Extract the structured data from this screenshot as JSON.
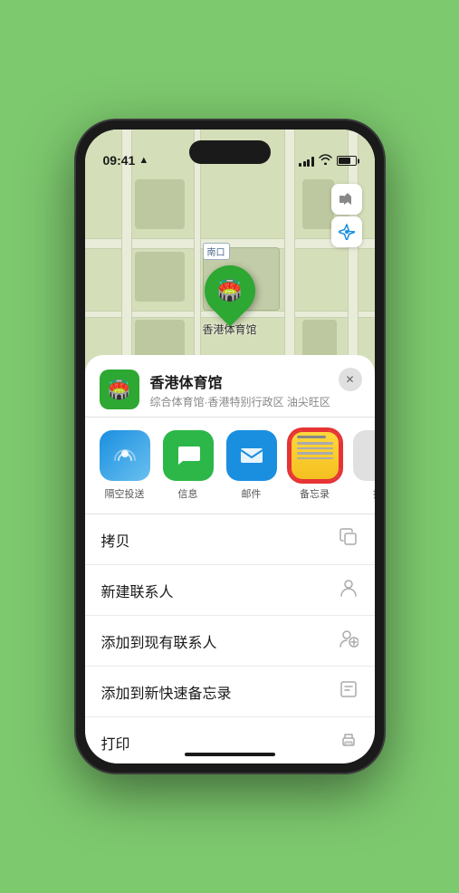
{
  "status_bar": {
    "time": "09:41",
    "location_arrow": "▶"
  },
  "map": {
    "label": "南口",
    "pin_label": "香港体育馆",
    "map_icon": "🗺️",
    "location_icon": "◎"
  },
  "venue": {
    "name": "香港体育馆",
    "subtitle": "综合体育馆·香港特别行政区 油尖旺区",
    "icon": "🏟️"
  },
  "share_items": [
    {
      "id": "airdrop",
      "label": "隔空投送",
      "emoji": "📡"
    },
    {
      "id": "messages",
      "label": "信息",
      "emoji": "💬"
    },
    {
      "id": "mail",
      "label": "邮件",
      "emoji": "✉️"
    },
    {
      "id": "notes",
      "label": "备忘录",
      "emoji": "notes"
    },
    {
      "id": "more",
      "label": "推",
      "emoji": "···"
    }
  ],
  "menu_items": [
    {
      "label": "拷贝",
      "icon": "copy"
    },
    {
      "label": "新建联系人",
      "icon": "person"
    },
    {
      "label": "添加到现有联系人",
      "icon": "person-add"
    },
    {
      "label": "添加到新快速备忘录",
      "icon": "note-add"
    },
    {
      "label": "打印",
      "icon": "printer"
    }
  ],
  "colors": {
    "green": "#2da832",
    "red": "#e63333",
    "blue": "#1a8fe0"
  }
}
